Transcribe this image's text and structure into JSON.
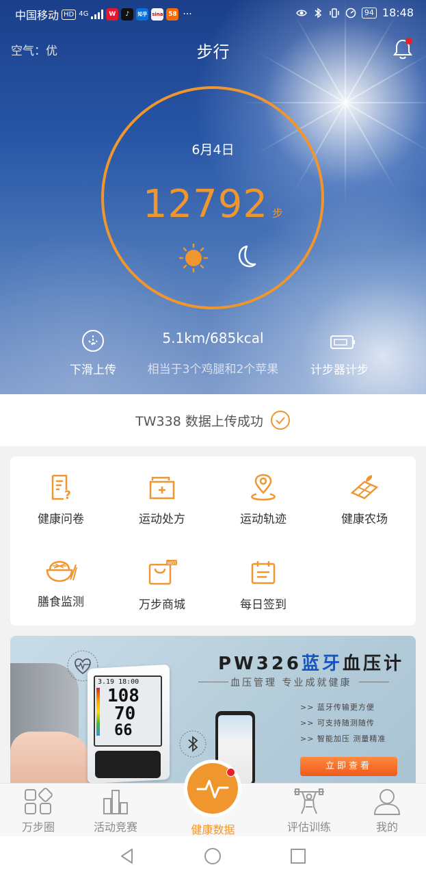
{
  "status_bar": {
    "carrier": "中国移动",
    "hd": "HD",
    "network": "4G",
    "battery": "94",
    "time": "18:48",
    "apps": [
      {
        "name": "weibo-app-icon",
        "text": "W",
        "color": "#e6162d"
      },
      {
        "name": "douyin-app-icon",
        "text": "♪",
        "color": "#111111"
      },
      {
        "name": "zhihu-app-icon",
        "text": "知乎",
        "color": "#0a6fd8"
      },
      {
        "name": "sina-app-icon",
        "text": "sina",
        "color": "#f5f5f5"
      },
      {
        "name": "app-icon-5",
        "text": "58",
        "color": "#ff6a00"
      }
    ],
    "more": "···"
  },
  "header": {
    "air_quality": "空气：优",
    "title": "步行"
  },
  "summary": {
    "date": "6月4日",
    "steps": "12792",
    "steps_unit": "步",
    "distance_calories": "5.1km/685kcal",
    "comparison": "相当于3个鸡腿和2个苹果",
    "left_action": "下滑上传",
    "right_action": "计步器计步"
  },
  "upload_status": {
    "text": "TW338 数据上传成功"
  },
  "features": [
    {
      "label": "健康问卷",
      "icon": "questionnaire-icon"
    },
    {
      "label": "运动处方",
      "icon": "prescription-folder-icon"
    },
    {
      "label": "运动轨迹",
      "icon": "location-track-icon"
    },
    {
      "label": "健康农场",
      "icon": "farm-icon"
    },
    {
      "label": "膳食监测",
      "icon": "diet-bowl-icon"
    },
    {
      "label": "万步商城",
      "icon": "shopping-bag-icon"
    },
    {
      "label": "每日签到",
      "icon": "calendar-checkin-icon"
    }
  ],
  "banner": {
    "title_prefix": "PW326",
    "title_highlight": "蓝牙",
    "title_suffix": "血压计",
    "subtitle": "血压管理 专业成就健康",
    "features": [
      ">> 蓝牙传输更方便",
      ">> 可支持随测随传",
      ">> 智能加压 测量精准"
    ],
    "button": "立即查看",
    "device_time": "3.19 18:00",
    "reading_sys": "108",
    "reading_dia": "70",
    "reading_pulse": "66"
  },
  "tabbar": {
    "items": [
      "万步圈",
      "活动竞赛",
      "健康数据",
      "评估训练",
      "我的"
    ],
    "active_index": 2
  },
  "colors": {
    "accent": "#f0962e",
    "banner_blue": "#1556c0",
    "badge_red": "#e8202a"
  }
}
